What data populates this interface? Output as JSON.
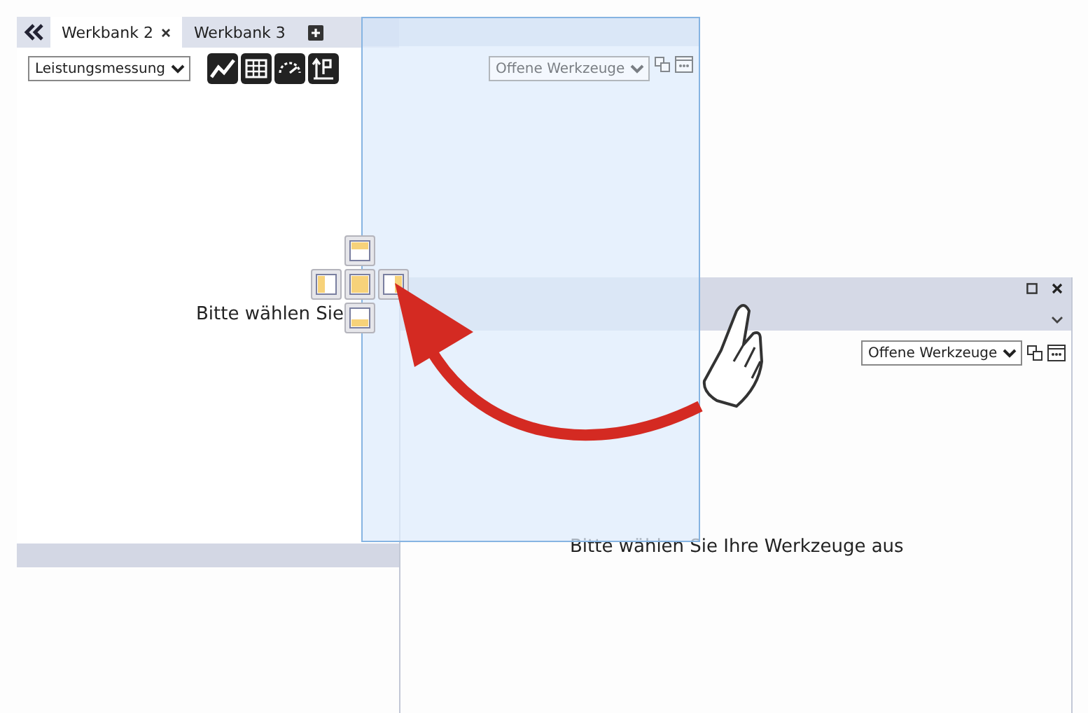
{
  "main_panel": {
    "tabs": [
      {
        "label": "Werkbank 2",
        "selected": true,
        "closable": true
      },
      {
        "label": "Werkbank 3",
        "selected": false,
        "closable": false
      }
    ],
    "tool_select": {
      "value": "Leistungsmessung"
    },
    "message": "Bitte wählen Sie"
  },
  "dock_preview": {
    "tool_select": {
      "value": "Offene Werkzeuge"
    }
  },
  "floating_window": {
    "tool_select": {
      "value": "Offene Werkzeuge"
    },
    "message": "Bitte wählen Sie Ihre Werkzeuge aus"
  }
}
